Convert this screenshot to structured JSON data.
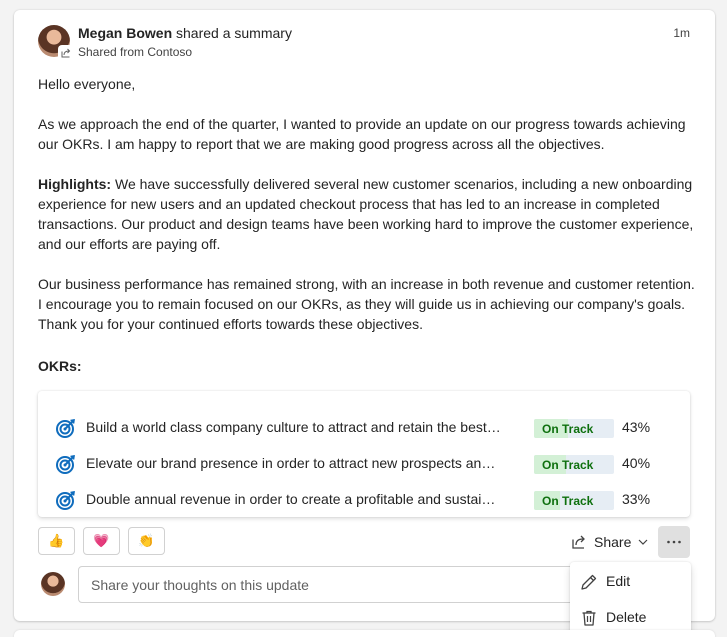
{
  "post": {
    "author": "Megan Bowen",
    "action": " shared a summary",
    "source": "Shared from Contoso",
    "timestamp": "1m"
  },
  "body": {
    "greeting": "Hello everyone,",
    "intro": "As we approach the end of the quarter, I wanted to provide an update on our progress towards achieving our OKRs. I am happy to report that we are making good progress across all the objectives.",
    "highlights_label": "Highlights:",
    "highlights_text": " We have successfully delivered several new customer scenarios, including a new onboarding experience for new users and an updated checkout process that has led to an increase in completed transactions. Our product and design teams have been working hard to improve the customer experience, and our efforts are paying off.",
    "closing": "Our business performance has remained strong, with an increase in both revenue and customer retention. I encourage you to remain focused on our OKRs, as they will guide us in achieving our company's goals. Thank you for your continued efforts towards these objectives."
  },
  "okrs": {
    "heading": "OKRs:",
    "items": [
      {
        "title": "Build a world class company culture to attract and retain the best talent",
        "status": "On Track",
        "percent": "43%",
        "progress": 0.43
      },
      {
        "title": "Elevate our brand presence in order to attract new prospects and customers",
        "status": "On Track",
        "percent": "40%",
        "progress": 0.4
      },
      {
        "title": "Double annual revenue in order to create a profitable and sustainable business",
        "status": "On Track",
        "percent": "33%",
        "progress": 0.33
      }
    ]
  },
  "reactions": [
    {
      "icon": "thumbs-up-icon",
      "glyph": "👍"
    },
    {
      "icon": "heart-icon",
      "glyph": "💗"
    },
    {
      "icon": "clap-icon",
      "glyph": "👏"
    }
  ],
  "actions": {
    "share_label": "Share"
  },
  "comment": {
    "placeholder": "Share your thoughts on this update"
  },
  "menu": {
    "edit_label": "Edit",
    "delete_label": "Delete"
  },
  "colors": {
    "accent": "#0f6cbd",
    "on_track_text": "#0e700e",
    "on_track_fill": "#d3f0d6",
    "track_bg": "#e6edf4"
  }
}
